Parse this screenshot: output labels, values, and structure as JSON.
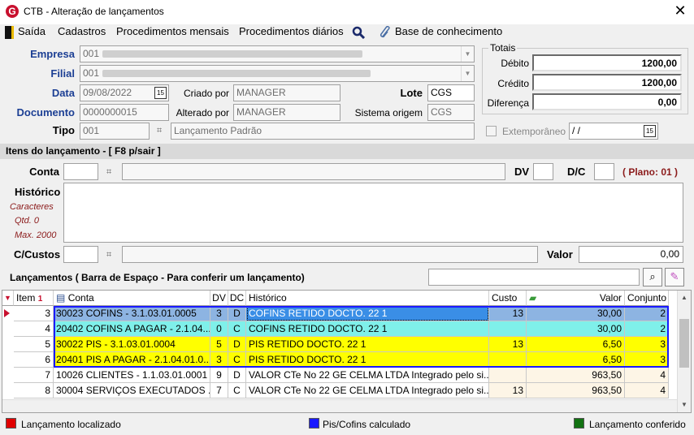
{
  "window": {
    "title": "CTB - Alteração de lançamentos"
  },
  "menu": {
    "saida": "Saída",
    "cadastros": "Cadastros",
    "procedimentos_mensais": "Procedimentos mensais",
    "procedimentos_diarios": "Procedimentos diários",
    "base_conhecimento": "Base de conhecimento"
  },
  "form": {
    "empresa_label": "Empresa",
    "empresa_value": "001",
    "filial_label": "Filial",
    "filial_value": "001",
    "data_label": "Data",
    "data_value": "09/08/2022",
    "criado_por_label": "Criado por",
    "criado_por_value": "MANAGER",
    "lote_label": "Lote",
    "lote_value": "CGS",
    "documento_label": "Documento",
    "documento_value": "0000000015",
    "alterado_por_label": "Alterado por",
    "alterado_por_value": "MANAGER",
    "sistema_origem_label": "Sistema origem",
    "sistema_origem_value": "CGS",
    "tipo_label": "Tipo",
    "tipo_value": "001",
    "tipo_desc": "Lançamento Padrão",
    "extemporaneo_label": "Extemporâneo",
    "extemporaneo_date": " / /"
  },
  "totais": {
    "title": "Totais",
    "debito_label": "Débito",
    "debito_value": "1200,00",
    "credito_label": "Crédito",
    "credito_value": "1200,00",
    "diferenca_label": "Diferença",
    "diferenca_value": "0,00"
  },
  "itens": {
    "section_title": "Itens do lançamento - [ F8 p/sair ]",
    "conta_label": "Conta",
    "dv_label": "DV",
    "dc_label": "D/C",
    "plano_label": "( Plano: 01 )",
    "historico_label": "Histórico",
    "caracteres_label": "Caracteres",
    "qtd_label": "Qtd. 0",
    "max_label": "Max. 2000",
    "ccustos_label": "C/Custos",
    "valor_label": "Valor",
    "valor_value": "0,00"
  },
  "lancamentos": {
    "title": "Lançamentos ( Barra de Espaço - Para conferir um lançamento)",
    "columns": {
      "item": "Item",
      "sort": "1",
      "conta": "Conta",
      "dv": "DV",
      "dc": "DC",
      "historico": "Histórico",
      "custo": "Custo",
      "valor": "Valor",
      "conjunto": "Conjunto"
    },
    "rows": [
      {
        "item": "3",
        "conta": "30023 COFINS - 3.1.03.01.0005",
        "dv": "3",
        "dc": "D",
        "historico": "COFINS RETIDO DOCTO. 22 1",
        "custo": "13",
        "valor": "30,00",
        "conjunto": "2"
      },
      {
        "item": "4",
        "conta": "20402 COFINS A PAGAR - 2.1.04....",
        "dv": "0",
        "dc": "C",
        "historico": "COFINS RETIDO DOCTO. 22 1",
        "custo": "",
        "valor": "30,00",
        "conjunto": "2"
      },
      {
        "item": "5",
        "conta": "30022 PIS - 3.1.03.01.0004",
        "dv": "5",
        "dc": "D",
        "historico": "PIS RETIDO DOCTO. 22 1",
        "custo": "13",
        "valor": "6,50",
        "conjunto": "3"
      },
      {
        "item": "6",
        "conta": "20401 PIS A PAGAR - 2.1.04.01.0...",
        "dv": "3",
        "dc": "C",
        "historico": "PIS RETIDO DOCTO. 22 1",
        "custo": "",
        "valor": "6,50",
        "conjunto": "3"
      },
      {
        "item": "7",
        "conta": "10026 CLIENTES - 1.1.03.01.0001",
        "dv": "9",
        "dc": "D",
        "historico": "VALOR CTe No 22 GE CELMA LTDA Integrado pelo si...",
        "custo": "",
        "valor": "963,50",
        "conjunto": "4"
      },
      {
        "item": "8",
        "conta": "30004 SERVIÇOS EXECUTADOS ...",
        "dv": "7",
        "dc": "C",
        "historico": "VALOR CTe No 22 GE CELMA LTDA Integrado pelo si...",
        "custo": "13",
        "valor": "963,50",
        "conjunto": "4"
      }
    ]
  },
  "legend": {
    "localizado": "Lançamento localizado",
    "pis_cofins": "Pis/Cofins calculado",
    "conferido": "Lançamento conferido"
  },
  "colors": {
    "row_blue": "#8db4e2",
    "row_cyan": "#7ff0ea",
    "row_yellow": "#ffff00",
    "row_cream": "#fdf5e6",
    "accent_red": "#c8102e",
    "plano_red": "#8b1a1a",
    "label_blue": "#1c3f94"
  }
}
